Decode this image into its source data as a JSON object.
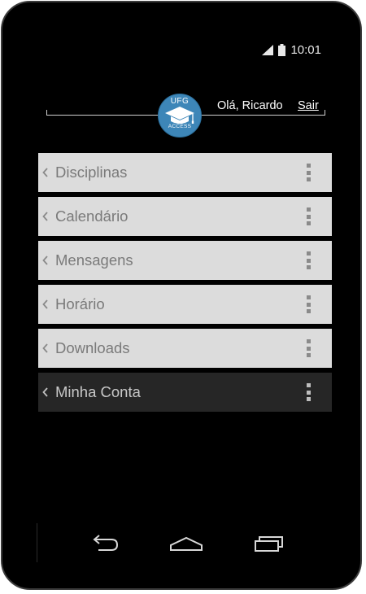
{
  "status_bar": {
    "time": "10:01",
    "icons": [
      "signal-icon",
      "battery-icon"
    ]
  },
  "header": {
    "logo": {
      "top_text": "UFG",
      "bottom_text": "ACCESS",
      "color": "#3d86b8"
    },
    "greeting": "Olá, Ricardo",
    "logout_label": "Sair"
  },
  "menu": {
    "items": [
      {
        "label": "Disciplinas",
        "active": false
      },
      {
        "label": "Calendário",
        "active": false
      },
      {
        "label": "Mensagens",
        "active": false
      },
      {
        "label": "Horário",
        "active": false
      },
      {
        "label": "Downloads",
        "active": false
      },
      {
        "label": "Minha Conta",
        "active": true
      }
    ]
  },
  "nav_bar": {
    "icons": [
      "back-icon",
      "home-icon",
      "recent-apps-icon"
    ]
  }
}
